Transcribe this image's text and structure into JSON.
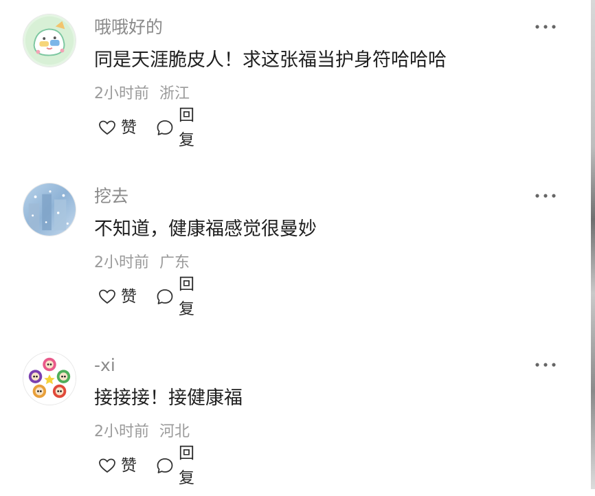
{
  "comments": [
    {
      "username": "哦哦好的",
      "content": "同是天涯脆皮人！求这张福当护身符哈哈哈",
      "time": "2小时前",
      "location": "浙江",
      "like_label": "赞",
      "reply_label": "回复",
      "more_icon": "more-icon"
    },
    {
      "username": "挖去",
      "content": "不知道，健康福感觉很曼妙",
      "time": "2小时前",
      "location": "广东",
      "like_label": "赞",
      "reply_label": "回复",
      "more_icon": "more-icon"
    },
    {
      "username": "-xi",
      "content": "接接接！接健康福",
      "time": "2小时前",
      "location": "河北",
      "like_label": "赞",
      "reply_label": "回复",
      "more_icon": "more-icon"
    }
  ],
  "colors": {
    "username": "#8a8a8a",
    "content": "#1f1f1f",
    "meta": "#9a9a9a",
    "action_text": "#2a2a2a"
  }
}
